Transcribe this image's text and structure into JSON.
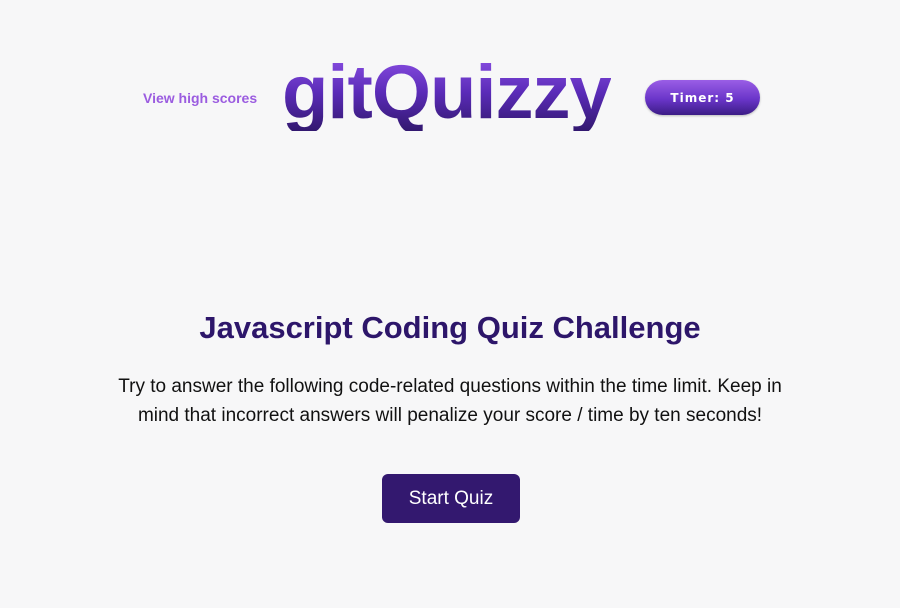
{
  "header": {
    "high_scores_link": "View high scores",
    "logo": "gitQuizzy",
    "timer": "Timer: 5"
  },
  "main": {
    "title": "Javascript Coding Quiz Challenge",
    "description": "Try to answer the following code-related questions within the time limit. Keep in mind that incorrect answers will penalize your score / time by ten seconds!",
    "start_button": "Start Quiz"
  },
  "colors": {
    "background": "#f7f7f8",
    "accent": "#9b5ce0",
    "brand_dark": "#33186f",
    "title": "#2d166a"
  }
}
